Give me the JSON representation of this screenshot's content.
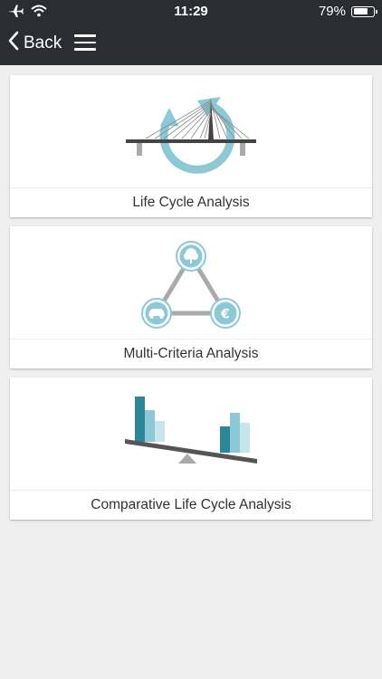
{
  "status": {
    "time": "11:29",
    "battery_pct": "79%",
    "battery_level": 0.79,
    "icons": [
      "airplane-icon",
      "wifi-icon",
      "battery-icon"
    ]
  },
  "nav": {
    "back_label": "Back",
    "icons": [
      "chevron-left-icon",
      "hamburger-menu-icon"
    ]
  },
  "cards": [
    {
      "label": "Life Cycle Analysis",
      "icon": "bridge-cycle-illustration"
    },
    {
      "label": "Multi-Criteria Analysis",
      "icon": "criteria-triangle-illustration"
    },
    {
      "label": "Comparative Life Cycle Analysis",
      "icon": "balance-bars-illustration"
    }
  ],
  "colors": {
    "topbar": "#2a2e33",
    "background": "#efefef",
    "accent_light": "#8cc9d6",
    "accent_dark": "#2b8796",
    "grey": "#999999"
  }
}
